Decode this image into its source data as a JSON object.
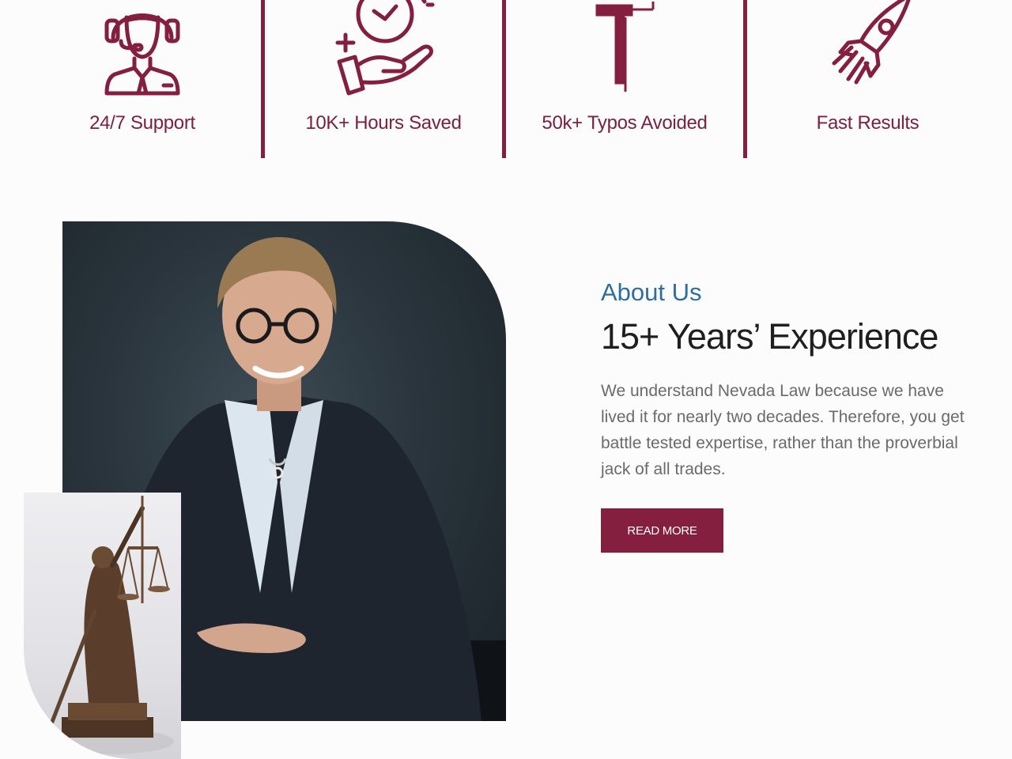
{
  "stats": [
    {
      "label": "24/7 Support",
      "icon": "headset-support-icon"
    },
    {
      "label": "10K+ Hours Saved",
      "icon": "hand-clock-icon"
    },
    {
      "label": "50k+ Typos Avoided",
      "icon": "text-cursor-icon"
    },
    {
      "label": "Fast Results",
      "icon": "rocket-icon"
    }
  ],
  "about": {
    "kicker": "About Us",
    "title": "15+ Years’ Experience",
    "body": "We understand Nevada Law because we have lived it for nearly two decades. Therefore, you get battle tested expertise, rather than the proverbial jack of all trades.",
    "button_label": "READ MORE"
  },
  "colors": {
    "accent": "#841f3f",
    "kicker": "#2e6e9e",
    "body_text": "#6a6a6a",
    "background": "#fcfcfc"
  }
}
